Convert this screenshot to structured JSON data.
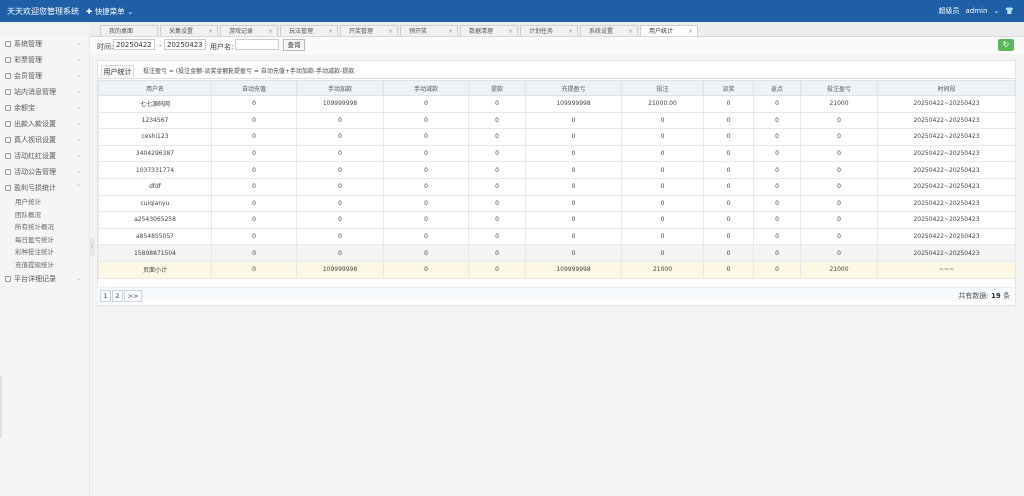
{
  "header": {
    "app_title": "天天欢迎您管理系统",
    "quick_menu": "快捷菜单",
    "role": "超级员",
    "user": "admin"
  },
  "tabs": [
    "我的桌面",
    "采集设置",
    "游戏记录",
    "玩法管理",
    "开奖管理",
    "预开奖",
    "数据清理",
    "计划任务",
    "系统设置",
    "用户统计"
  ],
  "sidebar": {
    "items": [
      "系统管理",
      "彩票管理",
      "会员管理",
      "站内消息管理",
      "余额宝",
      "出款入款设置",
      "真人视讯设置",
      "活动红红设置",
      "活动公告管理",
      "盈利亏损统计"
    ],
    "sub_items": [
      "用户统计",
      "团队概况",
      "所有统计概况",
      "每日盈亏统计",
      "彩种投注统计",
      "充值提现统计"
    ],
    "last_item": "平台详细记录"
  },
  "filter": {
    "time_label": "时间:",
    "start_date": "20250422",
    "dash": "-",
    "end_date": "20250423",
    "username_label": "用户名:",
    "username_value": "",
    "query_button": "查询"
  },
  "refresh_icon": "refresh-icon",
  "panel": {
    "tab_label": "用户统计",
    "formula1": "投注盈亏 = (投注金额-派奖金额)",
    "formula2": "充提盈亏 = 自动充值+手动加款-手动减款-提款"
  },
  "table": {
    "headers": [
      "用户名",
      "自动充值",
      "手动加款",
      "手动减款",
      "提款",
      "充提盈亏",
      "投注",
      "派奖",
      "返点",
      "投注盈亏",
      "时间段"
    ],
    "rows": [
      [
        "七七源码网",
        "0",
        "109999998",
        "0",
        "0",
        "109999998",
        "21000.00",
        "0",
        "0",
        "21000",
        "20250422~20250423"
      ],
      [
        "1234567",
        "0",
        "0",
        "0",
        "0",
        "0",
        "0",
        "0",
        "0",
        "0",
        "20250422~20250423"
      ],
      [
        "ceshi123",
        "0",
        "0",
        "0",
        "0",
        "0",
        "0",
        "0",
        "0",
        "0",
        "20250422~20250423"
      ],
      [
        "3404296387",
        "0",
        "0",
        "0",
        "0",
        "0",
        "0",
        "0",
        "0",
        "0",
        "20250422~20250423"
      ],
      [
        "1037331774",
        "0",
        "0",
        "0",
        "0",
        "0",
        "0",
        "0",
        "0",
        "0",
        "20250422~20250423"
      ],
      [
        "dfdf",
        "0",
        "0",
        "0",
        "0",
        "0",
        "0",
        "0",
        "0",
        "0",
        "20250422~20250423"
      ],
      [
        "cuiqianyu",
        "0",
        "0",
        "0",
        "0",
        "0",
        "0",
        "0",
        "0",
        "0",
        "20250422~20250423"
      ],
      [
        "a2543065258",
        "0",
        "0",
        "0",
        "0",
        "0",
        "0",
        "0",
        "0",
        "0",
        "20250422~20250423"
      ],
      [
        "a854855057",
        "0",
        "0",
        "0",
        "0",
        "0",
        "0",
        "0",
        "0",
        "0",
        "20250422~20250423"
      ],
      [
        "15898871504",
        "0",
        "0",
        "0",
        "0",
        "0",
        "0",
        "0",
        "0",
        "0",
        "20250422~20250423"
      ]
    ],
    "total": [
      "页面小计",
      "0",
      "109999998",
      "0",
      "0",
      "109999998",
      "21000",
      "0",
      "0",
      "21000",
      "~~~"
    ]
  },
  "pager": {
    "pages": [
      "1",
      "2",
      ">>"
    ],
    "count_label": "共有数据:",
    "count_value": "19",
    "count_unit": "条"
  }
}
